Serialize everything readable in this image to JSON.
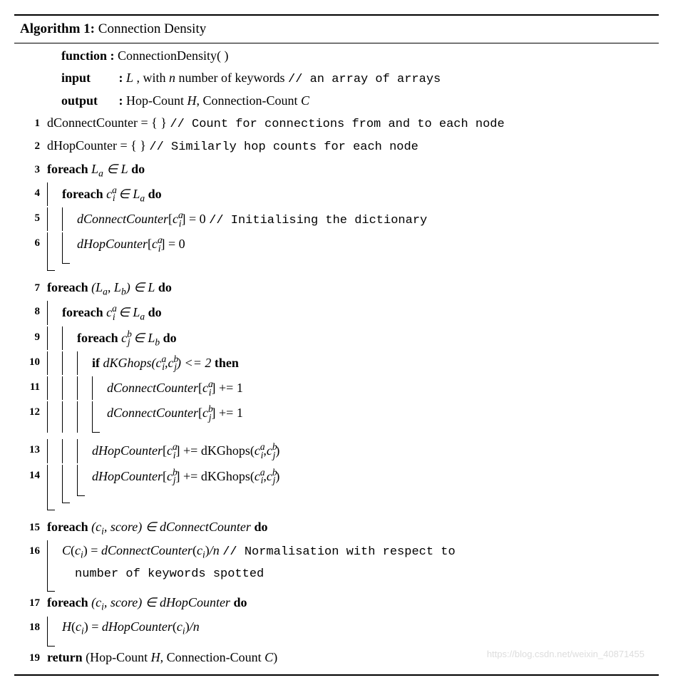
{
  "header": {
    "algo_label": "Algorithm 1:",
    "title": "Connection Density"
  },
  "decl": {
    "function_kw": "function :",
    "function_name": "ConnectionDensity( )",
    "input_kw": "input",
    "input_colon": ":",
    "input_body_prefix": ", with ",
    "input_body_suffix": " number of keywords",
    "input_comment": "// an array of arrays",
    "output_kw": "output",
    "output_colon": ":",
    "output_hop": "Hop-Count ",
    "output_conn": ", Connection-Count "
  },
  "lines": {
    "l1_a": "dConnectCounter = { }",
    "l1_c": "// Count for connections from and to each node",
    "l2_a": "dHopCounter = { }",
    "l2_c": "// Similarly hop counts for each node",
    "foreach": "foreach",
    "do": "do",
    "if": "if",
    "then": "then",
    "in": " ∈ ",
    "l3_loop_a": "L",
    "l3_loop_sub": "a",
    "l4_loop_var": "c",
    "l4_loop_sup": "a",
    "l4_loop_sub": "i",
    "l5_a": "dConnectCounter",
    "l5_b": " = 0",
    "l5_c": "// Initialising the dictionary",
    "l6_a": "dHopCounter",
    "l6_b": " = 0",
    "l7_pair_a": "L",
    "l7_pair_asub": "a",
    "l7_pair_b": "L",
    "l7_pair_bsub": "b",
    "l9_sup": "b",
    "l9_sub": "j",
    "l10_fn": "dKGhops",
    "l10_op": " <= 2",
    "l11_inc": " += 1",
    "l13_a": "dHopCounter",
    "l13_plus": " += dKGhops",
    "l15_pair": "score",
    "l15_in": "dConnectCounter",
    "l16_a": "dConnectCounter",
    "l16_div": "/n",
    "l16_c1": "// Normalisation with respect to",
    "l16_c2": "number of keywords spotted",
    "l17_in": "dHopCounter",
    "l18_a": "dHopCounter",
    "return_kw": "return",
    "return_hop": "Hop-Count ",
    "return_conn": ", Connection-Count ",
    "L_cal": "L",
    "H_cal": "H",
    "C_cal": "C",
    "n_var": "n",
    "c_var": "c",
    "i_sub": "i"
  },
  "watermark": "https://blog.csdn.net/weixin_40871455"
}
